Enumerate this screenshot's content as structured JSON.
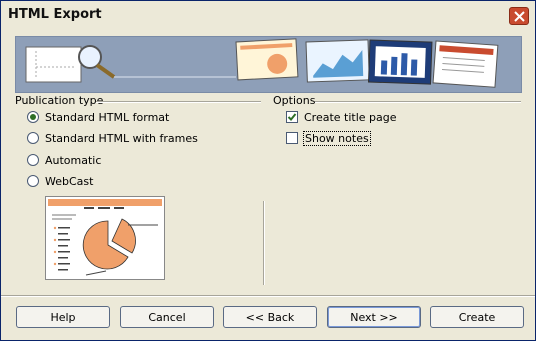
{
  "window": {
    "title": "HTML Export"
  },
  "publication_type": {
    "heading": "Publication type",
    "options": [
      {
        "label": "Standard HTML format",
        "selected": true
      },
      {
        "label": "Standard HTML with frames",
        "selected": false
      },
      {
        "label": "Automatic",
        "selected": false
      },
      {
        "label": "WebCast",
        "selected": false
      }
    ]
  },
  "options": {
    "heading": "Options",
    "items": [
      {
        "label": "Create title page",
        "checked": true
      },
      {
        "label": "Show notes",
        "checked": false
      }
    ]
  },
  "buttons": {
    "help": "Help",
    "cancel": "Cancel",
    "back": "<< Back",
    "next": "Next >>",
    "create": "Create"
  },
  "colors": {
    "accent": "#f0a06a",
    "banner": "#8e9fb8",
    "selected_radio": "#2e6f26"
  }
}
